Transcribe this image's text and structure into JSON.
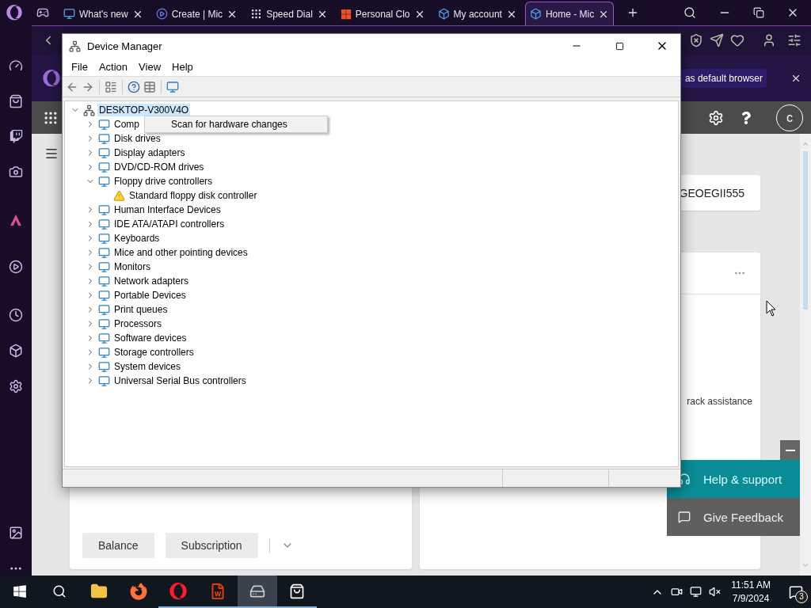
{
  "browser": {
    "tabs": [
      {
        "label": "What's new",
        "selected": false
      },
      {
        "label": "Create | Mic",
        "selected": false
      },
      {
        "label": "Speed Dial",
        "selected": false
      },
      {
        "label": "Personal Clo",
        "selected": false
      },
      {
        "label": "My account",
        "selected": false
      },
      {
        "label": "Home - Mic",
        "selected": true
      }
    ],
    "notification": {
      "button": "as default browser"
    }
  },
  "account_page": {
    "avatar": "c",
    "account_id": "GEOEGII555",
    "card_text": "rack assistance",
    "buttons": [
      "Balance",
      "Subscription"
    ],
    "help_button": "Help & support",
    "feedback_button": "Give Feedback"
  },
  "device_manager": {
    "title": "Device Manager",
    "menu": [
      "File",
      "Action",
      "View",
      "Help"
    ],
    "tree": {
      "label": "DESKTOP-V300V4O",
      "expanded": true,
      "selected": true,
      "children": [
        {
          "label": "Comp",
          "expanded": false
        },
        {
          "label": "Disk drives",
          "expanded": false
        },
        {
          "label": "Display adapters",
          "expanded": false
        },
        {
          "label": "DVD/CD-ROM drives",
          "expanded": false
        },
        {
          "label": "Floppy drive controllers",
          "expanded": true,
          "children": [
            {
              "label": "Standard floppy disk controller",
              "warning": true
            }
          ]
        },
        {
          "label": "Human Interface Devices",
          "expanded": false
        },
        {
          "label": "IDE ATA/ATAPI controllers",
          "expanded": false
        },
        {
          "label": "Keyboards",
          "expanded": false
        },
        {
          "label": "Mice and other pointing devices",
          "expanded": false
        },
        {
          "label": "Monitors",
          "expanded": false
        },
        {
          "label": "Network adapters",
          "expanded": false
        },
        {
          "label": "Portable Devices",
          "expanded": false
        },
        {
          "label": "Print queues",
          "expanded": false
        },
        {
          "label": "Processors",
          "expanded": false
        },
        {
          "label": "Software devices",
          "expanded": false
        },
        {
          "label": "Storage controllers",
          "expanded": false
        },
        {
          "label": "System devices",
          "expanded": false
        },
        {
          "label": "Universal Serial Bus controllers",
          "expanded": false
        }
      ]
    },
    "context_menu": [
      "Scan for hardware changes"
    ]
  },
  "taskbar": {
    "apps": [
      {
        "running": false,
        "selected": false
      },
      {
        "running": false,
        "selected": false
      },
      {
        "running": true,
        "selected": false
      },
      {
        "running": true,
        "selected": false
      },
      {
        "running": true,
        "selected": true
      },
      {
        "running": true,
        "selected": false
      }
    ],
    "time": "11:51 AM",
    "date": "7/9/2024",
    "notifications": "3"
  }
}
